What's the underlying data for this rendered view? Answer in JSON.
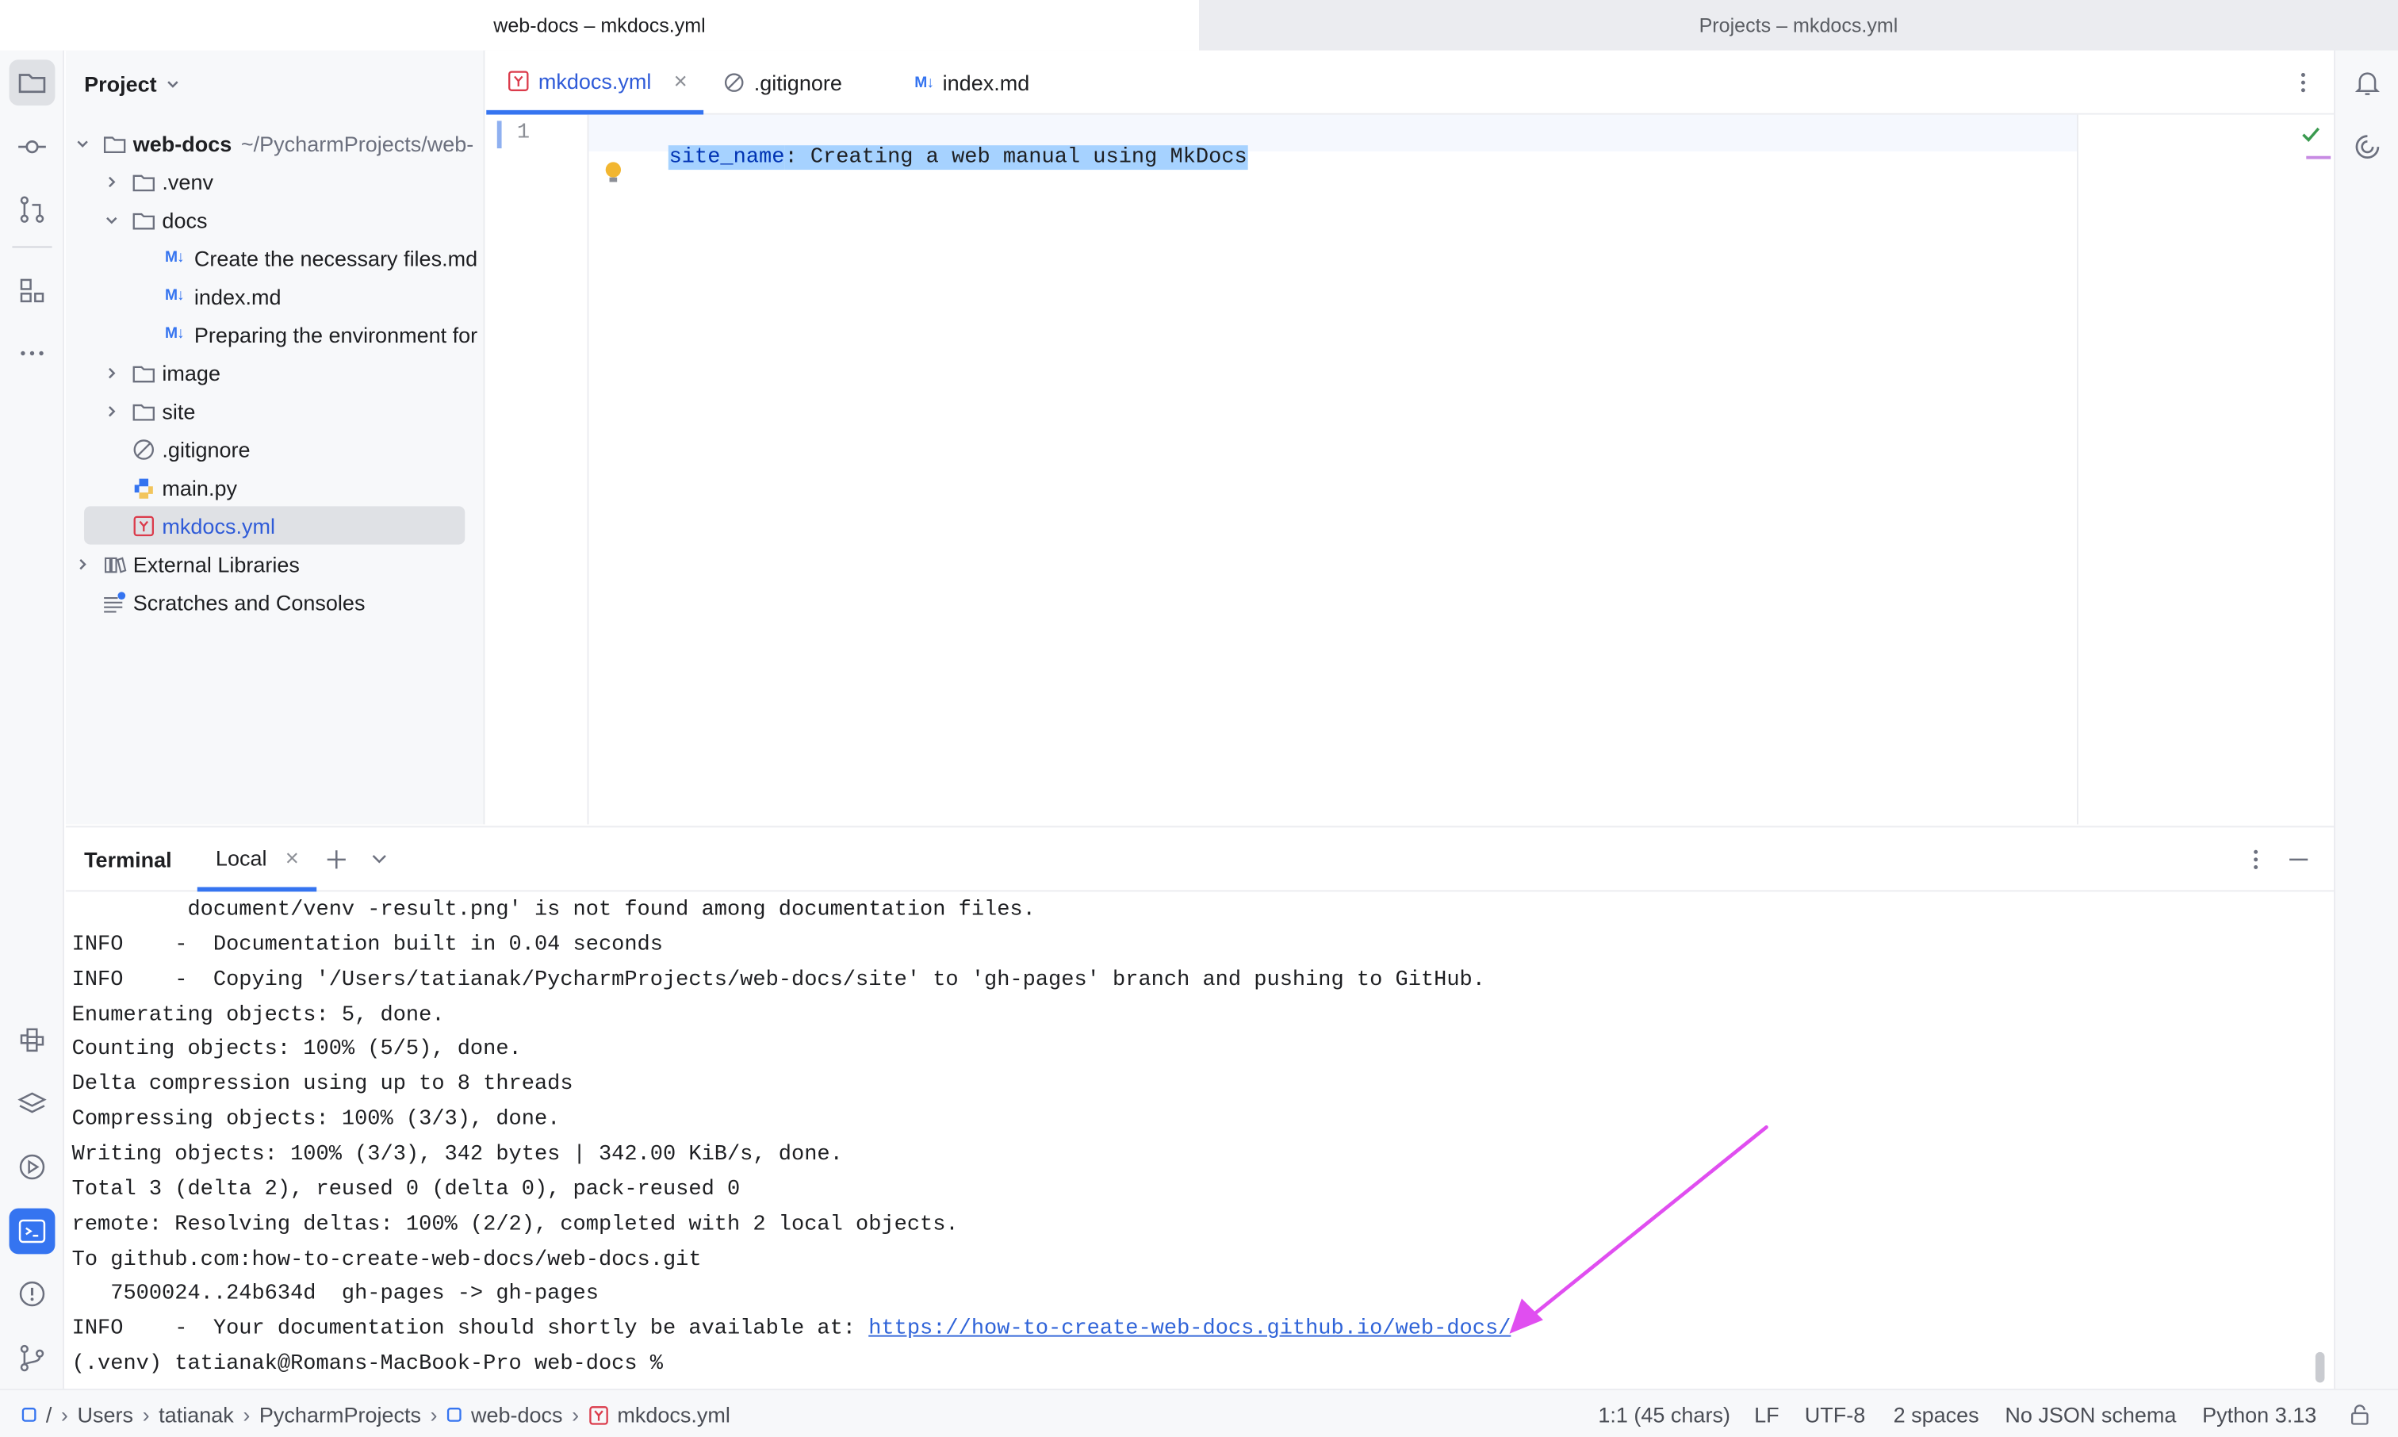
{
  "window_tabs": [
    "web-docs – mkdocs.yml",
    "Projects – mkdocs.yml"
  ],
  "project_panel": {
    "title": "Project",
    "root": {
      "name": "web-docs",
      "path": "~/PycharmProjects/web-"
    },
    "items": [
      ".venv",
      "docs",
      "Create the necessary files.md",
      "index.md",
      "Preparing the environment for",
      "image",
      "site",
      ".gitignore",
      "main.py",
      "mkdocs.yml",
      "External Libraries",
      "Scratches and Consoles"
    ],
    "md_badge": "M↓"
  },
  "editor": {
    "tabs": [
      "mkdocs.yml",
      ".gitignore",
      "index.md"
    ],
    "line_number": "1",
    "code_key": "site_name",
    "code_value": ": Creating a web manual using MkDocs"
  },
  "terminal": {
    "title": "Terminal",
    "tab": "Local",
    "lines": [
      "         document/venv -result.png' is not found among documentation files.",
      "INFO    -  Documentation built in 0.04 seconds",
      "INFO    -  Copying '/Users/tatianak/PycharmProjects/web-docs/site' to 'gh-pages' branch and pushing to GitHub.",
      "Enumerating objects: 5, done.",
      "Counting objects: 100% (5/5), done.",
      "Delta compression using up to 8 threads",
      "Compressing objects: 100% (3/3), done.",
      "Writing objects: 100% (3/3), 342 bytes | 342.00 KiB/s, done.",
      "Total 3 (delta 2), reused 0 (delta 0), pack-reused 0",
      "remote: Resolving deltas: 100% (2/2), completed with 2 local objects.",
      "To github.com:how-to-create-web-docs/web-docs.git",
      "   7500024..24b634d  gh-pages -> gh-pages"
    ],
    "info_prefix": "INFO    -  Your documentation should shortly be available at: ",
    "info_link": "https://how-to-create-web-docs.github.io/web-docs/",
    "prompt": "(.venv) tatianak@Romans-MacBook-Pro web-docs %"
  },
  "status_bar": {
    "breadcrumbs": [
      "/",
      "Users",
      "tatianak",
      "PycharmProjects",
      "web-docs",
      "mkdocs.yml"
    ],
    "position": "1:1 (45 chars)",
    "line_sep": "LF",
    "encoding": "UTF-8",
    "indent": "2 spaces",
    "schema": "No JSON schema",
    "interpreter": "Python 3.13"
  },
  "colors": {
    "accent": "#3574f0",
    "annotation_arrow": "#e04ef0",
    "selection": "#a6d2ff",
    "yaml_key": "#0033b3"
  },
  "icons": [
    "folder-icon",
    "commit-icon",
    "pull-requests-icon",
    "structure-icon",
    "more-icon",
    "python-console-icon",
    "layers-icon",
    "services-icon",
    "terminal-icon",
    "problems-icon",
    "git-icon",
    "notifications-icon",
    "ai-assistant-icon"
  ]
}
